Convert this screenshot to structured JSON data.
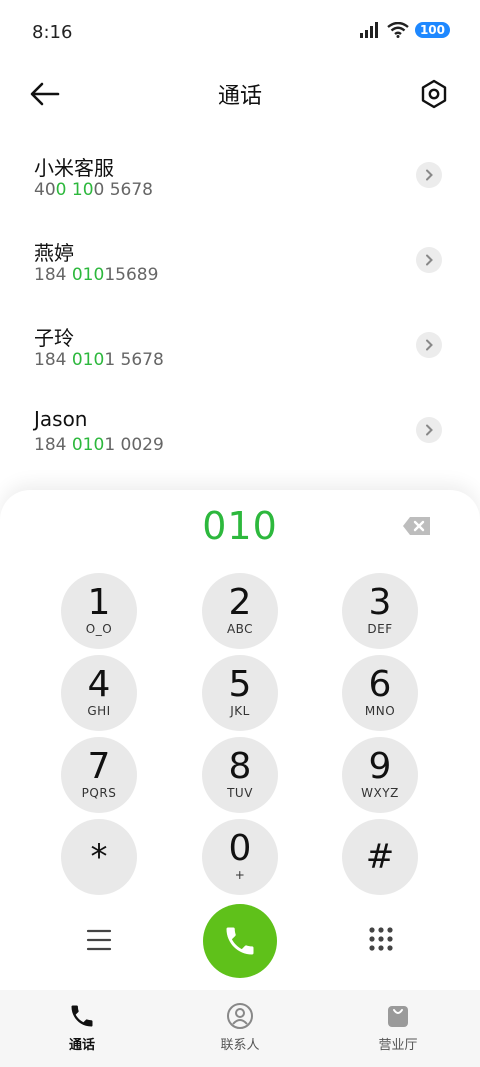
{
  "status_bar": {
    "time": "8:16",
    "battery": "100"
  },
  "header": {
    "title": "通话"
  },
  "contacts": [
    {
      "name": "小米客服",
      "number_parts": [
        [
          "40",
          false
        ],
        [
          "0",
          true
        ],
        [
          " ",
          false
        ],
        [
          "10",
          true
        ],
        [
          "0 5678",
          false
        ]
      ]
    },
    {
      "name": "燕婷",
      "number_parts": [
        [
          "184 ",
          false
        ],
        [
          "010",
          true
        ],
        [
          "15689",
          false
        ]
      ]
    },
    {
      "name": "子玲",
      "number_parts": [
        [
          "184 ",
          false
        ],
        [
          "010",
          true
        ],
        [
          "1 5678",
          false
        ]
      ]
    },
    {
      "name": "Jason",
      "number_parts": [
        [
          "184 ",
          false
        ],
        [
          "010",
          true
        ],
        [
          "1 0029",
          false
        ]
      ]
    }
  ],
  "dialer": {
    "input": "010",
    "keys": [
      {
        "digit": "1",
        "letters": "O_O"
      },
      {
        "digit": "2",
        "letters": "ABC"
      },
      {
        "digit": "3",
        "letters": "DEF"
      },
      {
        "digit": "4",
        "letters": "GHI"
      },
      {
        "digit": "5",
        "letters": "JKL"
      },
      {
        "digit": "6",
        "letters": "MNO"
      },
      {
        "digit": "7",
        "letters": "PQRS"
      },
      {
        "digit": "8",
        "letters": "TUV"
      },
      {
        "digit": "9",
        "letters": "WXYZ"
      },
      {
        "digit": "*",
        "letters": ""
      },
      {
        "digit": "0",
        "letters": "+"
      },
      {
        "digit": "#",
        "letters": ""
      }
    ]
  },
  "bottom_nav": [
    {
      "label": "通话",
      "icon": "phone-icon",
      "active": true
    },
    {
      "label": "联系人",
      "icon": "contact-person-icon",
      "active": false
    },
    {
      "label": "营业厅",
      "icon": "shopping-bag-icon",
      "active": false
    }
  ],
  "colors": {
    "accent": "#2db83d",
    "call": "#5fc11a",
    "battery": "#1e88ff"
  }
}
